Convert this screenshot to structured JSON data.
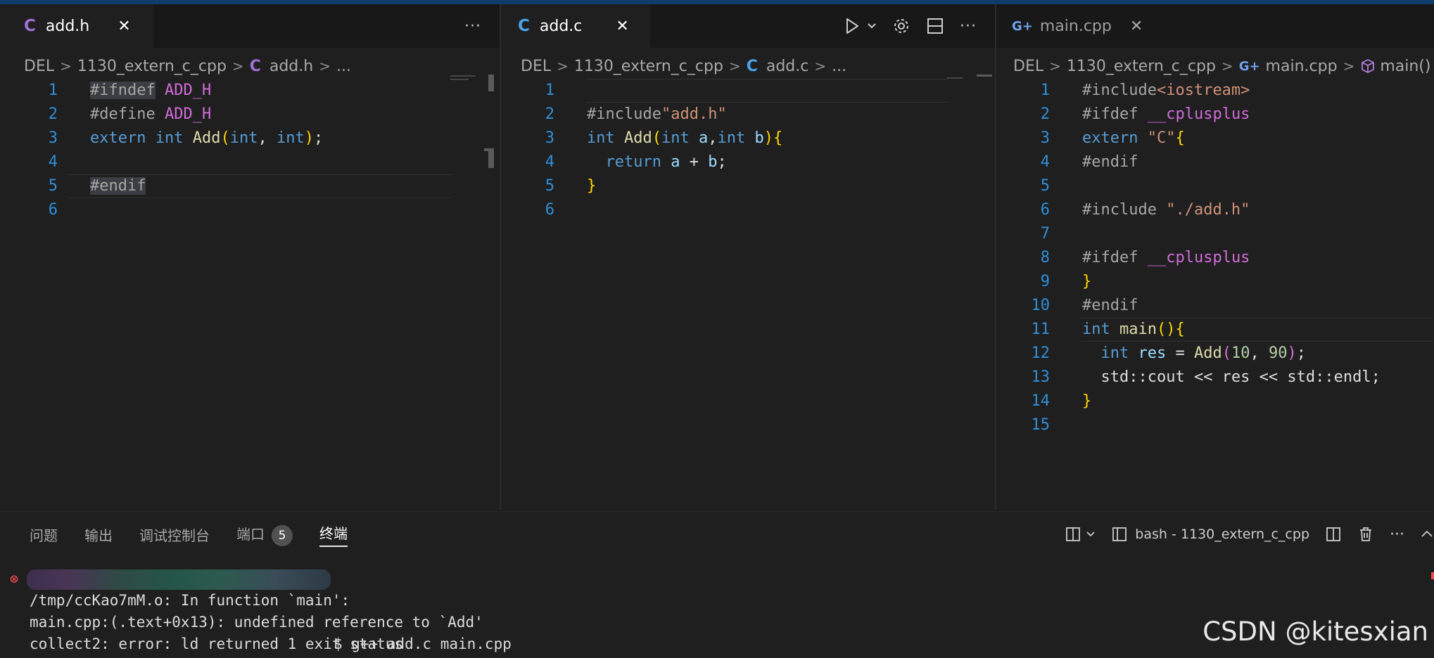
{
  "colors": {
    "c_icon": "#4aa3e8",
    "cpp_icon": "#6fa2f0",
    "accent_blue": "#0f3d6b",
    "error": "#f14c4c"
  },
  "editors": {
    "left": {
      "tab": {
        "icon": "C",
        "title": "add.h",
        "close": "✕"
      },
      "more": "···",
      "breadcrumb": {
        "root": "DEL",
        "folder": "1130_extern_c_cpp",
        "file_icon": "C",
        "file": "add.h",
        "tail": "..."
      },
      "lines": [
        {
          "n": "1",
          "parts": [
            [
              "pp selword",
              "#ifndef"
            ],
            [
              "",
              " "
            ],
            [
              "mac",
              "ADD_H"
            ]
          ]
        },
        {
          "n": "2",
          "parts": [
            [
              "pp",
              "#define"
            ],
            [
              "",
              " "
            ],
            [
              "mac",
              "ADD_H"
            ]
          ]
        },
        {
          "n": "3",
          "parts": [
            [
              "kw",
              "extern"
            ],
            [
              "",
              " "
            ],
            [
              "kw",
              "int"
            ],
            [
              "",
              " "
            ],
            [
              "fn",
              "Add"
            ],
            [
              "br1",
              "("
            ],
            [
              "kw",
              "int"
            ],
            [
              "var",
              ", "
            ],
            [
              "kw",
              "int"
            ],
            [
              "br1",
              ")"
            ],
            [
              "var",
              ";"
            ]
          ]
        },
        {
          "n": "4",
          "parts": []
        },
        {
          "n": "5",
          "parts": [
            [
              "pp selword",
              "#endif"
            ]
          ]
        },
        {
          "n": "6",
          "parts": []
        }
      ]
    },
    "mid": {
      "tab": {
        "icon": "C",
        "title": "add.c",
        "close": "✕"
      },
      "more": "···",
      "breadcrumb": {
        "root": "DEL",
        "folder": "1130_extern_c_cpp",
        "file_icon": "C",
        "file": "add.c",
        "tail": "..."
      },
      "lines": [
        {
          "n": "1",
          "parts": []
        },
        {
          "n": "2",
          "parts": [
            [
              "pp",
              "#include"
            ],
            [
              "str",
              "\"add.h\""
            ]
          ]
        },
        {
          "n": "3",
          "parts": [
            [
              "kw",
              "int"
            ],
            [
              "",
              " "
            ],
            [
              "fn",
              "Add"
            ],
            [
              "br1",
              "("
            ],
            [
              "kw",
              "int"
            ],
            [
              "",
              " "
            ],
            [
              "param",
              "a"
            ],
            [
              "var",
              ","
            ],
            [
              "kw",
              "int"
            ],
            [
              "",
              " "
            ],
            [
              "param",
              "b"
            ],
            [
              "br1",
              ")"
            ],
            [
              "br1",
              "{"
            ]
          ]
        },
        {
          "n": "4",
          "parts": [
            [
              "",
              "  "
            ],
            [
              "kw",
              "return"
            ],
            [
              "",
              " "
            ],
            [
              "param",
              "a"
            ],
            [
              "var",
              " + "
            ],
            [
              "param",
              "b"
            ],
            [
              "var",
              ";"
            ]
          ]
        },
        {
          "n": "5",
          "parts": [
            [
              "br1",
              "}"
            ]
          ]
        },
        {
          "n": "6",
          "parts": []
        }
      ]
    },
    "right": {
      "tab": {
        "icon": "G+",
        "title": "main.cpp",
        "close": "✕"
      },
      "breadcrumb": {
        "root": "DEL",
        "folder": "1130_extern_c_cpp",
        "file_icon": "G+",
        "file": "main.cpp",
        "symbol_icon": "cube-icon",
        "symbol": "main()"
      },
      "lines": [
        {
          "n": "1",
          "parts": [
            [
              "pp",
              "#include"
            ],
            [
              "str",
              "<iostream>"
            ]
          ]
        },
        {
          "n": "2",
          "parts": [
            [
              "pp",
              "#ifdef"
            ],
            [
              "",
              " "
            ],
            [
              "mac",
              "__cplusplus"
            ]
          ]
        },
        {
          "n": "3",
          "parts": [
            [
              "kw",
              "extern"
            ],
            [
              "",
              " "
            ],
            [
              "str",
              "\"C\""
            ],
            [
              "br1",
              "{"
            ]
          ]
        },
        {
          "n": "4",
          "parts": [
            [
              "pp",
              "#endif"
            ]
          ]
        },
        {
          "n": "5",
          "parts": []
        },
        {
          "n": "6",
          "parts": [
            [
              "pp",
              "#include"
            ],
            [
              "",
              " "
            ],
            [
              "str",
              "\"./add.h\""
            ]
          ]
        },
        {
          "n": "7",
          "parts": []
        },
        {
          "n": "8",
          "parts": [
            [
              "pp",
              "#ifdef"
            ],
            [
              "",
              " "
            ],
            [
              "mac",
              "__cplusplus"
            ]
          ]
        },
        {
          "n": "9",
          "parts": [
            [
              "br1",
              "}"
            ]
          ]
        },
        {
          "n": "10",
          "parts": [
            [
              "pp",
              "#endif"
            ]
          ]
        },
        {
          "n": "11",
          "parts": [
            [
              "kw",
              "int"
            ],
            [
              "",
              " "
            ],
            [
              "fn",
              "main"
            ],
            [
              "br1",
              "()"
            ],
            [
              "br1",
              "{"
            ]
          ]
        },
        {
          "n": "12",
          "parts": [
            [
              "",
              "  "
            ],
            [
              "kw",
              "int"
            ],
            [
              "",
              " "
            ],
            [
              "param",
              "res"
            ],
            [
              "var",
              " = "
            ],
            [
              "fn",
              "Add"
            ],
            [
              "br2",
              "("
            ],
            [
              "num",
              "10"
            ],
            [
              "var",
              ", "
            ],
            [
              "num",
              "90"
            ],
            [
              "br2",
              ")"
            ],
            [
              "var",
              ";"
            ]
          ]
        },
        {
          "n": "13",
          "parts": [
            [
              "",
              "  "
            ],
            [
              "var",
              "std::cout << res << std::endl;"
            ]
          ]
        },
        {
          "n": "14",
          "parts": [
            [
              "br1",
              "}"
            ]
          ]
        },
        {
          "n": "15",
          "parts": []
        }
      ]
    }
  },
  "panel": {
    "tabs": [
      "问题",
      "输出",
      "调试控制台",
      "端口",
      "终端"
    ],
    "ports_badge": "5",
    "terminal_name": "bash - 1130_extern_c_cpp",
    "terminal_lines": [
      {
        "text": "$ g++ add.c main.cpp"
      },
      {
        "text": "/tmp/ccKao7mM.o: In function `main':"
      },
      {
        "text": "main.cpp:(.text+0x13): undefined reference to `Add'"
      },
      {
        "text": "collect2: error: ld returned 1 exit status"
      }
    ]
  },
  "watermark": "CSDN @kitesxian"
}
